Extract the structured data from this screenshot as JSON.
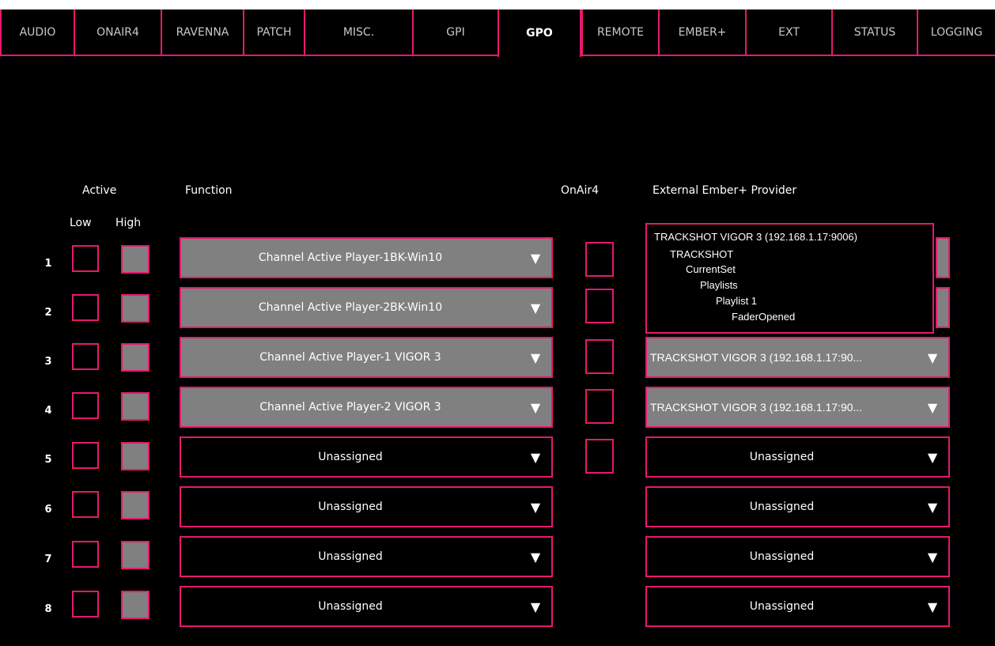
{
  "tabs": [
    {
      "label": "AUDIO"
    },
    {
      "label": "ONAIR4"
    },
    {
      "label": "RAVENNA"
    },
    {
      "label": "PATCH"
    },
    {
      "label": "MISC."
    },
    {
      "label": "GPI"
    },
    {
      "label": "GPO"
    },
    {
      "label": "REMOTE"
    },
    {
      "label": "EMBER+"
    },
    {
      "label": "EXT"
    },
    {
      "label": "STATUS"
    },
    {
      "label": "LOGGING"
    }
  ],
  "active_tab": "GPO",
  "headers": {
    "active": "Active",
    "low": "Low",
    "high": "High",
    "function": "Function",
    "onair4": "OnAir4",
    "ext_provider": "External Ember+ Provider"
  },
  "rows": [
    {
      "num": "1",
      "function": "Channel Active Player-1BK-Win10",
      "provider": ""
    },
    {
      "num": "2",
      "function": "Channel Active Player-2BK-Win10",
      "provider": ""
    },
    {
      "num": "3",
      "function": "Channel Active Player-1 VIGOR 3",
      "provider": "TRACKSHOT VIGOR 3 (192.168.1.17:90..."
    },
    {
      "num": "4",
      "function": "Channel Active Player-2 VIGOR 3",
      "provider": "TRACKSHOT VIGOR 3 (192.168.1.17:90..."
    },
    {
      "num": "5",
      "function": "Unassigned",
      "provider": "Unassigned"
    },
    {
      "num": "6",
      "function": "Unassigned",
      "provider": "Unassigned"
    },
    {
      "num": "7",
      "function": "Unassigned",
      "provider": "Unassigned"
    },
    {
      "num": "8",
      "function": "Unassigned",
      "provider": "Unassigned"
    }
  ],
  "dropdown_arrow": "▼",
  "tree_popup": [
    "TRACKSHOT  VIGOR 3 (192.168.1.17:9006)",
    "TRACKSHOT",
    "CurrentSet",
    "Playlists",
    "Playlist 1",
    "FaderOpened"
  ],
  "colors": {
    "accent": "#e6196e",
    "panel": "#000000",
    "filled": "#808080"
  }
}
